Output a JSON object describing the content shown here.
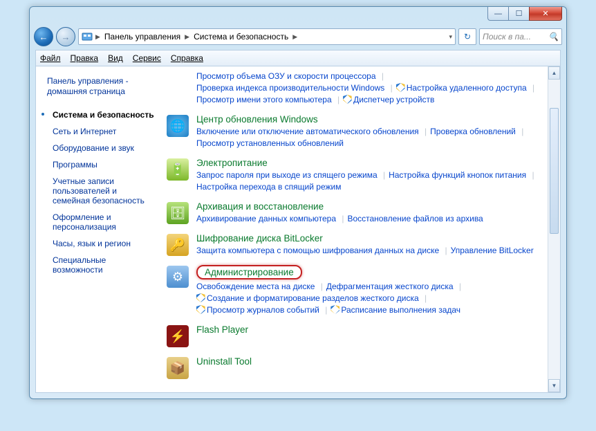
{
  "caption": {
    "min": "—",
    "max": "☐",
    "close": "✕"
  },
  "nav": {
    "back": "←",
    "fwd": "→",
    "refresh": "↻",
    "dropdown": "▾"
  },
  "breadcrumbs": [
    "Панель управления",
    "Система и безопасность"
  ],
  "search_placeholder": "Поиск в па...",
  "menu": {
    "file": "Файл",
    "edit": "Правка",
    "view": "Вид",
    "tools": "Сервис",
    "help": "Справка"
  },
  "sidebar": {
    "home": "Панель управления - домашняя страница",
    "items": [
      {
        "label": "Система и безопасность",
        "current": true
      },
      {
        "label": "Сеть и Интернет"
      },
      {
        "label": "Оборудование и звук"
      },
      {
        "label": "Программы"
      },
      {
        "label": "Учетные записи пользователей и семейная безопасность"
      },
      {
        "label": "Оформление и персонализация"
      },
      {
        "label": "Часы, язык и регион"
      },
      {
        "label": "Специальные возможности"
      }
    ]
  },
  "categories": [
    {
      "title": "",
      "icon": "",
      "partial": true,
      "links": [
        {
          "t": "Просмотр объема ОЗУ и скорости процессора"
        },
        {
          "t": "Проверка индекса производительности Windows"
        },
        {
          "t": "Настройка удаленного доступа",
          "shield": true
        },
        {
          "t": "Просмотр имени этого компьютера"
        },
        {
          "t": "Диспетчер устройств",
          "shield": true
        }
      ]
    },
    {
      "title": "Центр обновления Windows",
      "icon": "globe",
      "links": [
        {
          "t": "Включение или отключение автоматического обновления"
        },
        {
          "t": "Проверка обновлений"
        },
        {
          "t": "Просмотр установленных обновлений"
        }
      ]
    },
    {
      "title": "Электропитание",
      "icon": "battery",
      "links": [
        {
          "t": "Запрос пароля при выходе из спящего режима"
        },
        {
          "t": "Настройка функций кнопок питания"
        },
        {
          "t": "Настройка перехода в спящий режим"
        }
      ]
    },
    {
      "title": "Архивация и восстановление",
      "icon": "backup",
      "links": [
        {
          "t": "Архивирование данных компьютера"
        },
        {
          "t": "Восстановление файлов из архива"
        }
      ]
    },
    {
      "title": "Шифрование диска BitLocker",
      "icon": "lock",
      "links": [
        {
          "t": "Защита компьютера с помощью шифрования данных на диске"
        },
        {
          "t": "Управление BitLocker"
        }
      ]
    },
    {
      "title": "Администрирование",
      "icon": "admin",
      "highlight": true,
      "links": [
        {
          "t": "Освобождение места на диске"
        },
        {
          "t": "Дефрагментация жесткого диска"
        },
        {
          "t": "Создание и форматирование разделов жесткого диска",
          "shield": true
        },
        {
          "t": "Просмотр журналов событий",
          "shield": true
        },
        {
          "t": "Расписание выполнения задач",
          "shield": true
        }
      ]
    },
    {
      "title": "Flash Player",
      "icon": "flash",
      "links": []
    },
    {
      "title": "Uninstall Tool",
      "icon": "uninstall",
      "links": []
    }
  ]
}
